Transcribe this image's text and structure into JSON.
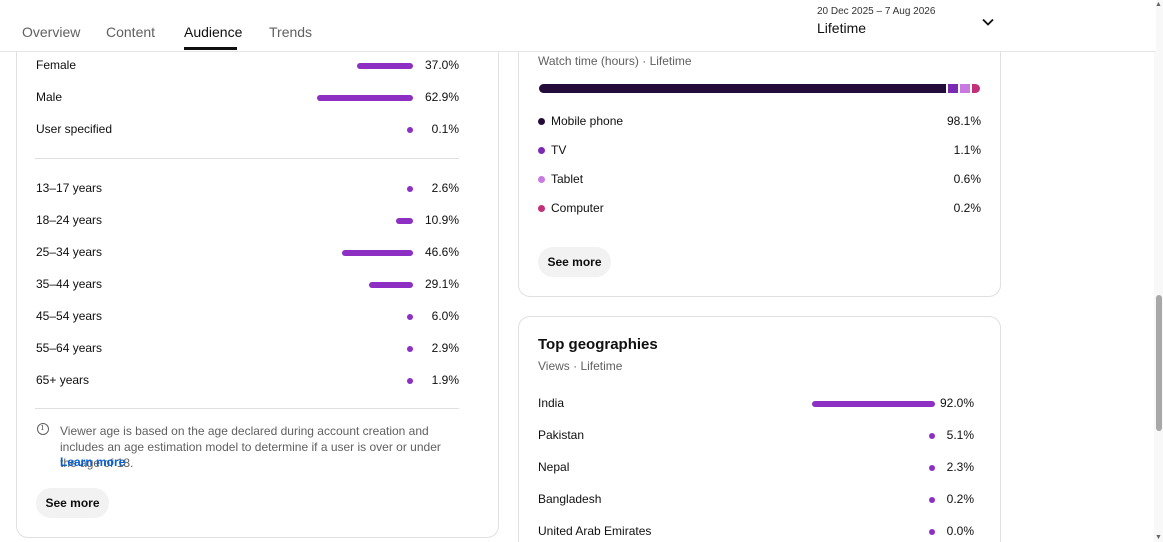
{
  "tabs": [
    {
      "label": "Overview"
    },
    {
      "label": "Content"
    },
    {
      "label": "Audience"
    },
    {
      "label": "Trends"
    }
  ],
  "date_range": "20 Dec 2025 – 7 Aug 2026",
  "period": "Lifetime",
  "gender": [
    {
      "label": "Female",
      "pct": "37.0%",
      "value": 37.0
    },
    {
      "label": "Male",
      "pct": "62.9%",
      "value": 62.9
    },
    {
      "label": "User specified",
      "pct": "0.1%",
      "value": 0.1
    }
  ],
  "age": [
    {
      "label": "13–17 years",
      "pct": "2.6%",
      "value": 2.6
    },
    {
      "label": "18–24 years",
      "pct": "10.9%",
      "value": 10.9
    },
    {
      "label": "25–34 years",
      "pct": "46.6%",
      "value": 46.6
    },
    {
      "label": "35–44 years",
      "pct": "29.1%",
      "value": 29.1
    },
    {
      "label": "45–54 years",
      "pct": "6.0%",
      "value": 6.0
    },
    {
      "label": "55–64 years",
      "pct": "2.9%",
      "value": 2.9
    },
    {
      "label": "65+ years",
      "pct": "1.9%",
      "value": 1.9
    }
  ],
  "age_note": "Viewer age is based on the age declared during account creation and includes an age estimation model to determine if a user is over or under the age of 18.",
  "learn_more": "Learn more",
  "see_more": "See more",
  "device": {
    "subtitle": "Watch time (hours) · Lifetime",
    "items": [
      {
        "label": "Mobile phone",
        "pct": "98.1%",
        "value": 98.1,
        "color": "#230b3a"
      },
      {
        "label": "TV",
        "pct": "1.1%",
        "value": 1.1,
        "color": "#7b2ab3"
      },
      {
        "label": "Tablet",
        "pct": "0.6%",
        "value": 0.6,
        "color": "#c77ae0"
      },
      {
        "label": "Computer",
        "pct": "0.2%",
        "value": 0.2,
        "color": "#c2307a"
      }
    ]
  },
  "geo": {
    "title": "Top geographies",
    "subtitle": "Views · Lifetime",
    "items": [
      {
        "label": "India",
        "pct": "92.0%",
        "value": 92.0
      },
      {
        "label": "Pakistan",
        "pct": "5.1%",
        "value": 5.1
      },
      {
        "label": "Nepal",
        "pct": "2.3%",
        "value": 2.3
      },
      {
        "label": "Bangladesh",
        "pct": "0.2%",
        "value": 0.2
      },
      {
        "label": "United Arab Emirates",
        "pct": "0.0%",
        "value": 0.0
      }
    ]
  },
  "colors": {
    "accent": "#8c2fc2",
    "link": "#065fd4"
  }
}
